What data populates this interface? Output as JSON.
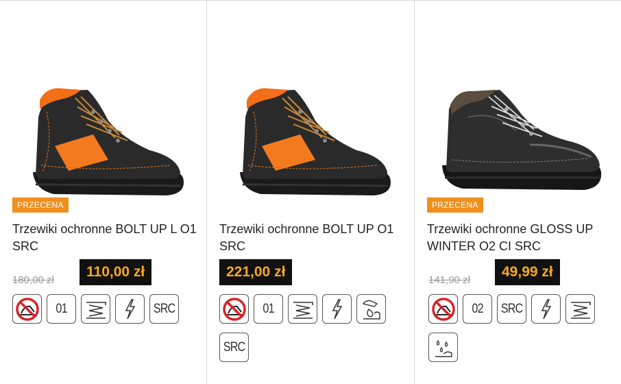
{
  "products": [
    {
      "badge": "PRZECENA",
      "title": "Trzewiki ochronne BOLT UP L O1 SRC",
      "old_price": "180,00 zł",
      "price": "110,00 zł",
      "image": "black-orange-boot",
      "icons": [
        {
          "name": "no-metal-icon"
        },
        {
          "name": "class-01-icon",
          "text": "01"
        },
        {
          "name": "shock-absorption-icon"
        },
        {
          "name": "antistatic-icon"
        },
        {
          "name": "src-slip-icon",
          "text": "SRC"
        }
      ]
    },
    {
      "title": "Trzewiki ochronne BOLT UP O1 SRC",
      "price": "221,00 zł",
      "image": "black-orange-boot",
      "icons": [
        {
          "name": "no-metal-icon"
        },
        {
          "name": "class-01-icon",
          "text": "01"
        },
        {
          "name": "shock-absorption-icon"
        },
        {
          "name": "antistatic-icon"
        },
        {
          "name": "oil-resistant-icon"
        },
        {
          "name": "src-slip-icon",
          "text": "SRC"
        }
      ]
    },
    {
      "badge": "PRZECENA",
      "title": "Trzewiki ochronne GLOSS UP WINTER O2 CI SRC",
      "old_price": "141,90 zł",
      "price": "49,99 zł",
      "image": "black-winter-boot",
      "icons": [
        {
          "name": "no-metal-icon"
        },
        {
          "name": "class-02-icon",
          "text": "02"
        },
        {
          "name": "src-slip-icon",
          "text": "SRC"
        },
        {
          "name": "antistatic-icon"
        },
        {
          "name": "shock-absorption-icon"
        },
        {
          "name": "water-resistant-icon"
        }
      ]
    }
  ],
  "colors": {
    "badge": "#f0901e",
    "price_bg": "#111111",
    "price_text": "#f7a91b"
  }
}
